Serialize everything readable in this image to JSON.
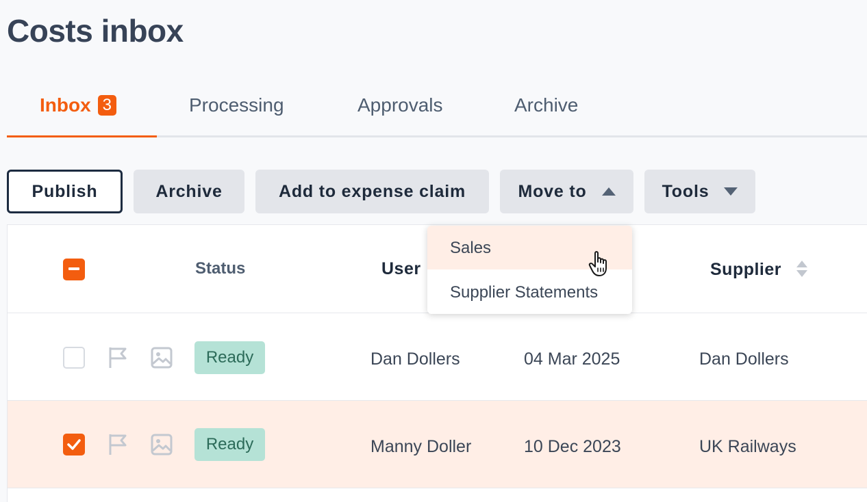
{
  "page": {
    "title": "Costs inbox"
  },
  "tabs": [
    {
      "label": "Inbox",
      "badge": "3",
      "active": true
    },
    {
      "label": "Processing"
    },
    {
      "label": "Approvals"
    },
    {
      "label": "Archive"
    }
  ],
  "toolbar": {
    "publish": "Publish",
    "archive": "Archive",
    "add_expense": "Add to expense claim",
    "move_to": "Move to",
    "tools": "Tools"
  },
  "table": {
    "headers": {
      "status": "Status",
      "user": "User",
      "supplier": "Supplier"
    },
    "rows": [
      {
        "status": "Ready",
        "user": "Dan Dollers",
        "date": "04 Mar 2025",
        "supplier": "Dan Dollers",
        "selected": false
      },
      {
        "status": "Ready",
        "user": "Manny Doller",
        "date": "10 Dec 2023",
        "supplier": "UK Railways",
        "selected": true
      }
    ]
  },
  "move_menu": {
    "items": [
      "Sales",
      "Supplier Statements"
    ]
  },
  "colors": {
    "accent": "#f35d0f",
    "status_ready_bg": "#b5e2d6",
    "selected_row": "#ffeee6"
  }
}
